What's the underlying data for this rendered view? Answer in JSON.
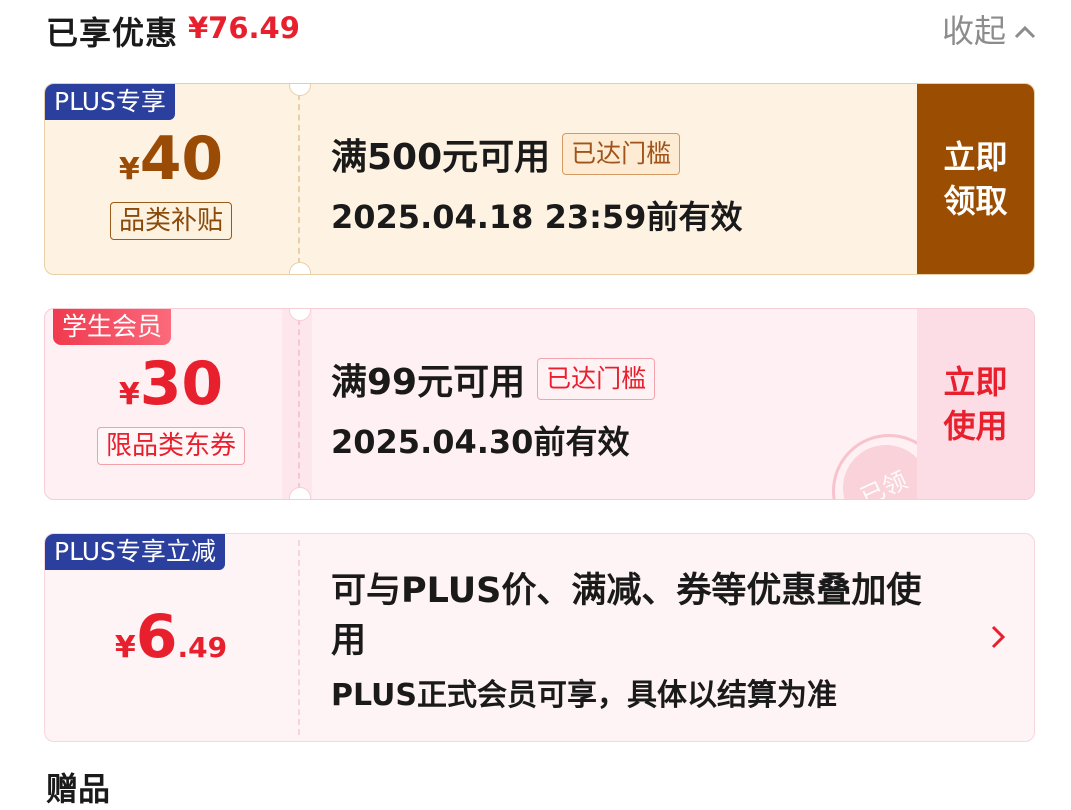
{
  "header": {
    "title": "已享优惠",
    "total": "¥76.49",
    "collapse_label": "收起"
  },
  "coupons": [
    {
      "tag": "PLUS专享",
      "currency": "¥",
      "amount": "40",
      "badge": "品类补贴",
      "condition": "满500元可用",
      "reached": "已达门槛",
      "validity": "2025.04.18 23:59前有效",
      "action_line1": "立即",
      "action_line2": "领取"
    },
    {
      "tag": "学生会员",
      "currency": "¥",
      "amount": "30",
      "badge": "限品类东券",
      "condition": "满99元可用",
      "reached": "已达门槛",
      "validity": "2025.04.30前有效",
      "action_line1": "立即",
      "action_line2": "使用",
      "stamp": "已领"
    }
  ],
  "plus_discount": {
    "tag": "PLUS专享立减",
    "currency": "¥",
    "amount_int": "6",
    "amount_dec": ".49",
    "desc": "可与PLUS价、满减、券等优惠叠加使用",
    "sub": "PLUS正式会员可享，具体以结算为准"
  },
  "next_section": {
    "title": "赠品"
  },
  "colors": {
    "accent_red": "#e8202e",
    "plus_blue": "#2a3f9e",
    "brown": "#9b4e02"
  },
  "icons": {
    "collapse": "chevron-up-icon",
    "details": "chevron-right-icon"
  }
}
